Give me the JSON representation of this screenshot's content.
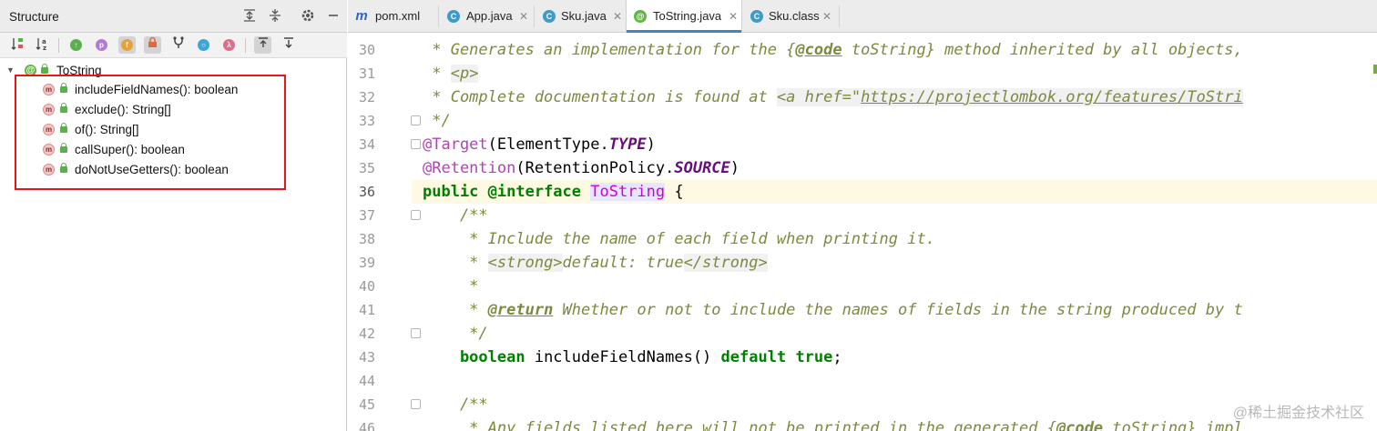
{
  "structure": {
    "title": "Structure",
    "root": {
      "label": "ToString",
      "expanded": true
    },
    "members": [
      {
        "label": "includeFieldNames(): boolean"
      },
      {
        "label": "exclude(): String[]"
      },
      {
        "label": "of(): String[]"
      },
      {
        "label": "callSuper(): boolean"
      },
      {
        "label": "doNotUseGetters(): boolean"
      }
    ],
    "toolbar_icons": [
      "sort-by-visibility-icon",
      "sort-alphabetically-icon",
      "show-inherited-icon",
      "show-properties-icon",
      "show-fields-icon",
      "show-non-public-icon",
      "show-lambdas-icon",
      "autoscroll-to-source-icon",
      "autoscroll-from-source-icon"
    ],
    "header_icons": [
      "expand-all-icon",
      "collapse-all-icon",
      "settings-icon",
      "minimize-icon"
    ]
  },
  "tabs": [
    {
      "label": "pom.xml",
      "icon": "m",
      "icon_color": "#2f64c8",
      "active": false,
      "closable": false
    },
    {
      "label": "App.java",
      "icon": "C",
      "icon_color": "#3d9ac9",
      "active": false,
      "closable": true
    },
    {
      "label": "Sku.java",
      "icon": "C",
      "icon_color": "#3d9ac9",
      "active": false,
      "closable": true
    },
    {
      "label": "ToString.java",
      "icon": "@",
      "icon_color": "#62b543",
      "active": true,
      "closable": true
    },
    {
      "label": "Sku.class",
      "icon": "C",
      "icon_color": "#3d9ac9",
      "active": false,
      "closable": true
    }
  ],
  "editor": {
    "line_numbers": [
      "30",
      "31",
      "32",
      "33",
      "34",
      "35",
      "36",
      "37",
      "38",
      "39",
      "40",
      "41",
      "42",
      "43",
      "44",
      "45",
      "46"
    ],
    "current_line": "36",
    "lines": {
      "l30": {
        "p1": " * Generates an implementation for the {",
        "p2": "@code",
        "p3": " toString} method inherited by all objects,"
      },
      "l31": {
        "p1": " * ",
        "p2": "<p>"
      },
      "l32": {
        "p1": " * Complete documentation is found at ",
        "p2": "<a href=\"",
        "p3": "https://projectlombok.org/features/ToStri"
      },
      "l33": {
        "p1": " */"
      },
      "l34": {
        "p1": "@Target",
        "p2": "(ElementType.",
        "p3": "TYPE",
        "p4": ")"
      },
      "l35": {
        "p1": "@Retention",
        "p2": "(RetentionPolicy.",
        "p3": "SOURCE",
        "p4": ")"
      },
      "l36": {
        "p1": "public",
        "p2": " @interface ",
        "p3": "ToString",
        "p4": " {"
      },
      "l37": {
        "p1": "    /**"
      },
      "l38": {
        "p1": "     * Include the name of each field when printing it."
      },
      "l39": {
        "p1": "     * ",
        "p2": "<strong>",
        "p3": "default: true",
        "p4": "</strong>"
      },
      "l40": {
        "p1": "     *"
      },
      "l41": {
        "p1": "     * ",
        "p2": "@return",
        "p3": " Whether or not to include the names of fields in the string produced by t"
      },
      "l42": {
        "p1": "     */"
      },
      "l43": {
        "p1": "    boolean",
        "p2": " includeFieldNames() ",
        "p3": "default",
        "p4": " ",
        "p5": "true",
        "p6": ";"
      },
      "l44": {
        "p1": ""
      },
      "l45": {
        "p1": "    /**"
      },
      "l46": {
        "p1": "     * Any fields listed here will not be printed in the generated {",
        "p2": "@code",
        "p3": " toString} impl"
      }
    }
  },
  "watermark": "@稀土掘金技术社区",
  "colors": {
    "highlight_box": "#e0181c",
    "active_tab_underline": "#4083c9",
    "current_line_bg": "#fdf9e3"
  }
}
